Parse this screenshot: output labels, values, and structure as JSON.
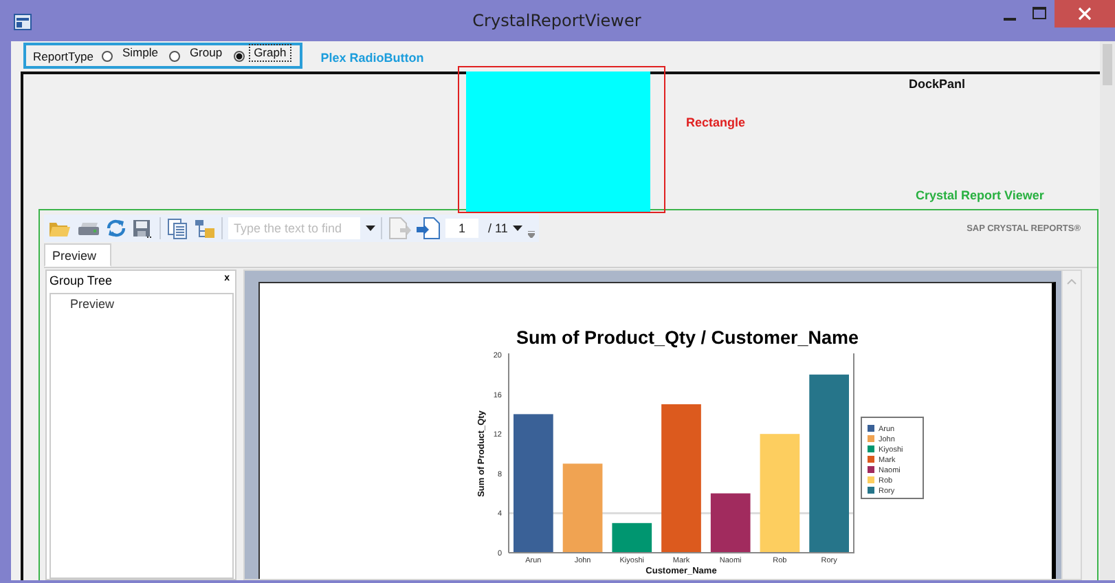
{
  "window": {
    "title": "CrystalReportViewer"
  },
  "report_type": {
    "label": "ReportType",
    "options": [
      {
        "label": "Simple",
        "selected": false
      },
      {
        "label": "Group",
        "selected": false
      },
      {
        "label": "Graph",
        "selected": true
      }
    ]
  },
  "designer_labels": {
    "radio": "Plex RadioButton",
    "rectangle": "Rectangle",
    "dock": "DockPanl",
    "viewer": "Crystal Report Viewer"
  },
  "viewer": {
    "toolbar": {
      "search_placeholder": "Type the text to find",
      "page": "1",
      "page_count": "/ 11",
      "brand": "SAP CRYSTAL REPORTS®"
    },
    "tabs": [
      {
        "label": "Preview",
        "selected": true
      }
    ],
    "group_tree": {
      "title": "Group Tree",
      "close": "x",
      "items": [
        {
          "label": "Preview"
        }
      ]
    },
    "chart_data": {
      "type": "bar",
      "title": "Sum of Product_Qty / Customer_Name",
      "xlabel": "Customer_Name",
      "ylabel": "Sum of Product_Qty",
      "categories": [
        "Arun",
        "John",
        "Kiyoshi",
        "Mark",
        "Naomi",
        "Rob",
        "Rory"
      ],
      "ylim": [
        0,
        20
      ],
      "yticks": [
        0,
        4,
        8,
        12,
        16,
        20
      ],
      "stacked": true,
      "legend": true,
      "series": [
        {
          "name": "Arun",
          "color": "#3a6197",
          "values": [
            14,
            null,
            null,
            null,
            null,
            null,
            null
          ]
        },
        {
          "name": "John",
          "color": "#f0a352",
          "values": [
            null,
            9,
            null,
            null,
            null,
            null,
            null
          ]
        },
        {
          "name": "Kiyoshi",
          "color": "#009670",
          "values": [
            null,
            null,
            3,
            null,
            null,
            null,
            null
          ]
        },
        {
          "name": "Mark",
          "color": "#dc5a1e",
          "values": [
            null,
            null,
            null,
            15,
            null,
            null,
            null
          ]
        },
        {
          "name": "Naomi",
          "color": "#a12b5e",
          "values": [
            null,
            null,
            null,
            null,
            6,
            null,
            null
          ]
        },
        {
          "name": "Rob",
          "color": "#fdce5f",
          "values": [
            null,
            null,
            null,
            null,
            null,
            12,
            null
          ]
        },
        {
          "name": "Rory",
          "color": "#26758a",
          "values": [
            null,
            null,
            null,
            null,
            null,
            null,
            18
          ]
        }
      ]
    }
  }
}
